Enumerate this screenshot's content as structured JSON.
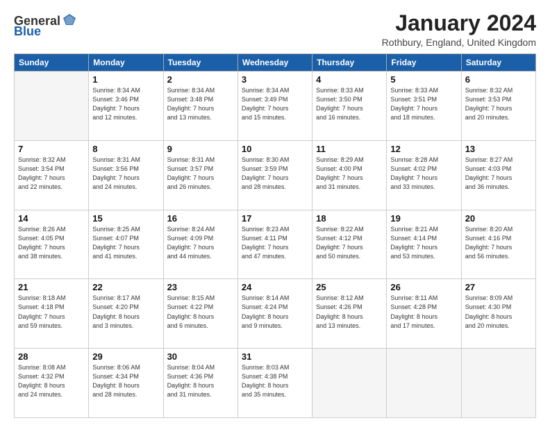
{
  "header": {
    "logo_general": "General",
    "logo_blue": "Blue",
    "title": "January 2024",
    "location": "Rothbury, England, United Kingdom"
  },
  "days_of_week": [
    "Sunday",
    "Monday",
    "Tuesday",
    "Wednesday",
    "Thursday",
    "Friday",
    "Saturday"
  ],
  "weeks": [
    [
      {
        "day": "",
        "info": ""
      },
      {
        "day": "1",
        "info": "Sunrise: 8:34 AM\nSunset: 3:46 PM\nDaylight: 7 hours\nand 12 minutes."
      },
      {
        "day": "2",
        "info": "Sunrise: 8:34 AM\nSunset: 3:48 PM\nDaylight: 7 hours\nand 13 minutes."
      },
      {
        "day": "3",
        "info": "Sunrise: 8:34 AM\nSunset: 3:49 PM\nDaylight: 7 hours\nand 15 minutes."
      },
      {
        "day": "4",
        "info": "Sunrise: 8:33 AM\nSunset: 3:50 PM\nDaylight: 7 hours\nand 16 minutes."
      },
      {
        "day": "5",
        "info": "Sunrise: 8:33 AM\nSunset: 3:51 PM\nDaylight: 7 hours\nand 18 minutes."
      },
      {
        "day": "6",
        "info": "Sunrise: 8:32 AM\nSunset: 3:53 PM\nDaylight: 7 hours\nand 20 minutes."
      }
    ],
    [
      {
        "day": "7",
        "info": "Sunrise: 8:32 AM\nSunset: 3:54 PM\nDaylight: 7 hours\nand 22 minutes."
      },
      {
        "day": "8",
        "info": "Sunrise: 8:31 AM\nSunset: 3:56 PM\nDaylight: 7 hours\nand 24 minutes."
      },
      {
        "day": "9",
        "info": "Sunrise: 8:31 AM\nSunset: 3:57 PM\nDaylight: 7 hours\nand 26 minutes."
      },
      {
        "day": "10",
        "info": "Sunrise: 8:30 AM\nSunset: 3:59 PM\nDaylight: 7 hours\nand 28 minutes."
      },
      {
        "day": "11",
        "info": "Sunrise: 8:29 AM\nSunset: 4:00 PM\nDaylight: 7 hours\nand 31 minutes."
      },
      {
        "day": "12",
        "info": "Sunrise: 8:28 AM\nSunset: 4:02 PM\nDaylight: 7 hours\nand 33 minutes."
      },
      {
        "day": "13",
        "info": "Sunrise: 8:27 AM\nSunset: 4:03 PM\nDaylight: 7 hours\nand 36 minutes."
      }
    ],
    [
      {
        "day": "14",
        "info": "Sunrise: 8:26 AM\nSunset: 4:05 PM\nDaylight: 7 hours\nand 38 minutes."
      },
      {
        "day": "15",
        "info": "Sunrise: 8:25 AM\nSunset: 4:07 PM\nDaylight: 7 hours\nand 41 minutes."
      },
      {
        "day": "16",
        "info": "Sunrise: 8:24 AM\nSunset: 4:09 PM\nDaylight: 7 hours\nand 44 minutes."
      },
      {
        "day": "17",
        "info": "Sunrise: 8:23 AM\nSunset: 4:11 PM\nDaylight: 7 hours\nand 47 minutes."
      },
      {
        "day": "18",
        "info": "Sunrise: 8:22 AM\nSunset: 4:12 PM\nDaylight: 7 hours\nand 50 minutes."
      },
      {
        "day": "19",
        "info": "Sunrise: 8:21 AM\nSunset: 4:14 PM\nDaylight: 7 hours\nand 53 minutes."
      },
      {
        "day": "20",
        "info": "Sunrise: 8:20 AM\nSunset: 4:16 PM\nDaylight: 7 hours\nand 56 minutes."
      }
    ],
    [
      {
        "day": "21",
        "info": "Sunrise: 8:18 AM\nSunset: 4:18 PM\nDaylight: 7 hours\nand 59 minutes."
      },
      {
        "day": "22",
        "info": "Sunrise: 8:17 AM\nSunset: 4:20 PM\nDaylight: 8 hours\nand 3 minutes."
      },
      {
        "day": "23",
        "info": "Sunrise: 8:15 AM\nSunset: 4:22 PM\nDaylight: 8 hours\nand 6 minutes."
      },
      {
        "day": "24",
        "info": "Sunrise: 8:14 AM\nSunset: 4:24 PM\nDaylight: 8 hours\nand 9 minutes."
      },
      {
        "day": "25",
        "info": "Sunrise: 8:12 AM\nSunset: 4:26 PM\nDaylight: 8 hours\nand 13 minutes."
      },
      {
        "day": "26",
        "info": "Sunrise: 8:11 AM\nSunset: 4:28 PM\nDaylight: 8 hours\nand 17 minutes."
      },
      {
        "day": "27",
        "info": "Sunrise: 8:09 AM\nSunset: 4:30 PM\nDaylight: 8 hours\nand 20 minutes."
      }
    ],
    [
      {
        "day": "28",
        "info": "Sunrise: 8:08 AM\nSunset: 4:32 PM\nDaylight: 8 hours\nand 24 minutes."
      },
      {
        "day": "29",
        "info": "Sunrise: 8:06 AM\nSunset: 4:34 PM\nDaylight: 8 hours\nand 28 minutes."
      },
      {
        "day": "30",
        "info": "Sunrise: 8:04 AM\nSunset: 4:36 PM\nDaylight: 8 hours\nand 31 minutes."
      },
      {
        "day": "31",
        "info": "Sunrise: 8:03 AM\nSunset: 4:38 PM\nDaylight: 8 hours\nand 35 minutes."
      },
      {
        "day": "",
        "info": ""
      },
      {
        "day": "",
        "info": ""
      },
      {
        "day": "",
        "info": ""
      }
    ]
  ]
}
